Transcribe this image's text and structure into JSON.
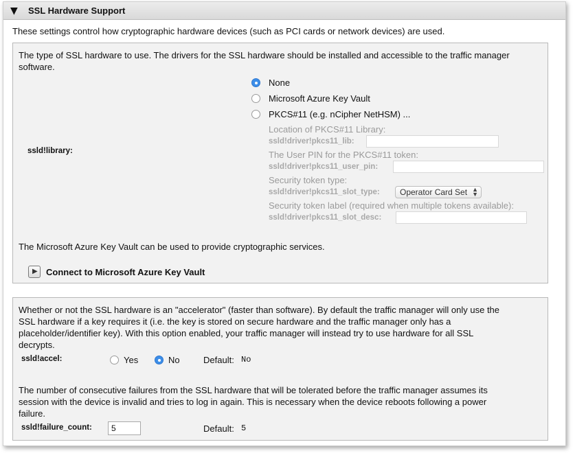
{
  "header": {
    "title": "SSL Hardware Support"
  },
  "intro": "These settings control how cryptographic hardware devices (such as PCI cards or network devices) are used.",
  "library": {
    "description_line1": "The type of SSL hardware to use. The drivers for the SSL hardware should be installed and accessible to the traffic manager",
    "description_line2": "software.",
    "label": "ssld!library:",
    "options": [
      {
        "label": "None",
        "selected": true
      },
      {
        "label": "Microsoft Azure Key Vault",
        "selected": false
      },
      {
        "label": "PKCS#11 (e.g. nCipher NetHSM) ...",
        "selected": false
      }
    ],
    "pkcs11": {
      "lib_desc": "Location of PKCS#11 Library:",
      "lib_label": "ssld!driver!pkcs11_lib:",
      "pin_desc": "The User PIN for the PKCS#11 token:",
      "pin_label": "ssld!driver!pkcs11_user_pin:",
      "slot_type_desc": "Security token type:",
      "slot_type_label": "ssld!driver!pkcs11_slot_type:",
      "slot_type_value": "Operator Card Set",
      "slot_desc_desc": "Security token label (required when multiple tokens available):",
      "slot_desc_label": "ssld!driver!pkcs11_slot_desc:"
    },
    "azure_note": "The Microsoft Azure Key Vault can be used to provide cryptographic services.",
    "azure_connect": "Connect to Microsoft Azure Key Vault"
  },
  "accel": {
    "description_line1": "Whether or not the SSL hardware is an \"accelerator\" (faster than software). By default the traffic manager will only use the",
    "description_line2": "SSL hardware if a key requires it (i.e. the key is stored on secure hardware and the traffic manager only has a",
    "description_line3": "placeholder/identifier key). With this option enabled, your traffic manager will instead try to use hardware for all SSL",
    "description_line4": "decrypts.",
    "label": "ssld!accel:",
    "yes_label": "Yes",
    "no_label": "No",
    "selected": "No",
    "default_label": "Default:",
    "default_value": "No"
  },
  "failure": {
    "description_line1": "The number of consecutive failures from the SSL hardware that will be tolerated before the traffic manager assumes its",
    "description_line2": "session with the device is invalid and tries to log in again. This is necessary when the device reboots following a power",
    "description_line3": "failure.",
    "label": "ssld!failure_count:",
    "value": "5",
    "default_label": "Default:",
    "default_value": "5"
  }
}
